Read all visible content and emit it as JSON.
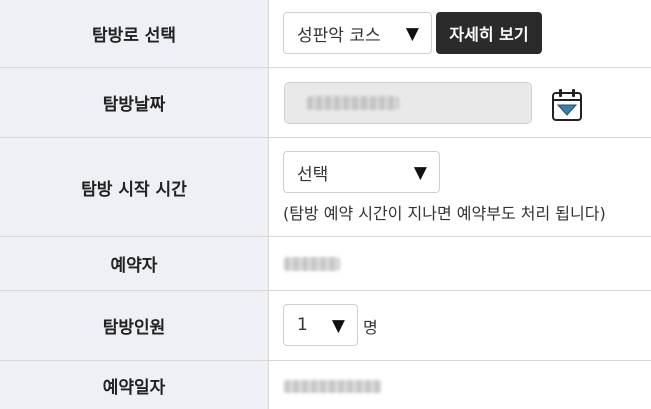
{
  "form": {
    "route": {
      "label": "탐방로 선택",
      "course_select_value": "성판악 코스",
      "details_button_label": "자세히 보기"
    },
    "date": {
      "label": "탐방날짜",
      "calendar_icon": "calendar-icon"
    },
    "start_time": {
      "label": "탐방 시작 시간",
      "select_value": "선택",
      "note": "(탐방 예약 시간이 지나면 예약부도 처리 됩니다)"
    },
    "reserver": {
      "label": "예약자"
    },
    "visitors": {
      "label": "탐방인원",
      "select_value": "1",
      "unit": "명"
    },
    "reservation_date": {
      "label": "예약일자"
    }
  },
  "colors": {
    "label_background": "#eef0f5",
    "border": "#d7d7d7",
    "dark_button": "#2b2b2b",
    "disabled_input": "#e9e9e9"
  },
  "icons": {
    "dropdown": "triangle-down",
    "calendar": "calendar-icon"
  }
}
